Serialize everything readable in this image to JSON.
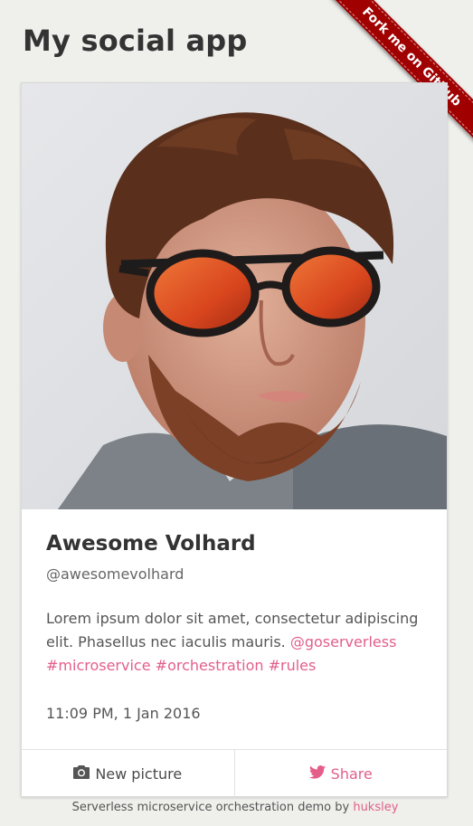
{
  "header": {
    "title": "My social app",
    "fork_ribbon": "Fork me on GitHub"
  },
  "profile": {
    "name": "Awesome Volhard",
    "handle": "@awesomevolhard",
    "bio_text": "Lorem ipsum dolor sit amet, consectetur adipiscing elit. Phasellus nec iaculis mauris.",
    "hashtags": [
      "@goserverless",
      "#microservice",
      "#orchestration",
      "#rules"
    ],
    "timestamp": "11:09 PM, 1 Jan 2016",
    "photo_icon": "profile-photo"
  },
  "actions": {
    "new_picture_label": "New picture",
    "new_picture_icon": "camera-icon",
    "share_label": "Share",
    "share_icon": "twitter-bird-icon"
  },
  "footer": {
    "credit_text": "Serverless microservice orchestration demo by",
    "credit_link": "huksley"
  },
  "colors": {
    "accent": "#e35f8a",
    "ribbon": "#a00000",
    "background": "#efefec"
  }
}
